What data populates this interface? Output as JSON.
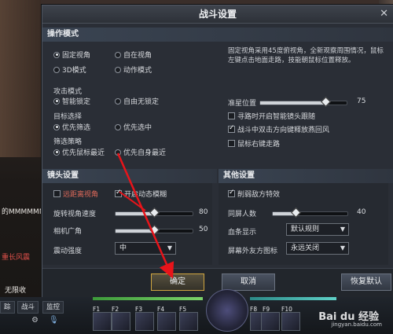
{
  "background": {
    "chat_line": "的MMMMMM",
    "red_text": "重长风震",
    "no_limit": "无限收",
    "hud_tabs": [
      "踪",
      "战斗",
      "监控"
    ]
  },
  "dialog": {
    "title": "战斗设置",
    "close_icon": "close-icon",
    "operation": {
      "header": "操作模式",
      "modes": [
        {
          "label": "固定视角",
          "selected": true
        },
        {
          "label": "自在视角",
          "selected": false
        },
        {
          "label": "3D模式",
          "selected": false
        },
        {
          "label": "动作模式",
          "selected": false
        }
      ],
      "description": "固定视角采用45度俯视角，全新观察周围情况，鼠标左键点击地面走路，技能朝鼠标位置释放。",
      "attack": {
        "title": "攻击模式",
        "options": [
          {
            "label": "智能锁定",
            "selected": true
          },
          {
            "label": "自由无锁定",
            "selected": false
          }
        ]
      },
      "target": {
        "title": "目标选择",
        "options": [
          {
            "label": "优先筛选",
            "selected": true
          },
          {
            "label": "优先选中",
            "selected": false
          }
        ]
      },
      "filter": {
        "title": "筛选策略",
        "options": [
          {
            "label": "优先鼠标最近",
            "selected": true
          },
          {
            "label": "优先自身最近",
            "selected": false
          }
        ]
      },
      "aim": {
        "label": "准星位置",
        "value": "75",
        "fraction": 0.75
      },
      "checks": [
        {
          "label": "寻路时开启智能镜头跟随",
          "checked": false
        },
        {
          "label": "战斗中双击方向键释放燕回风",
          "checked": true
        },
        {
          "label": "鼠标右键走路",
          "checked": false
        }
      ]
    },
    "camera": {
      "header": "镜头设置",
      "far_view": {
        "label": "远距离视角",
        "checked": false
      },
      "dynamic_blur": {
        "label": "开启动态模糊",
        "checked": true
      },
      "rotation_speed": {
        "label": "旋转视角速度",
        "value": "80",
        "fraction": 0.5
      },
      "fov": {
        "label": "相机广角",
        "value": "50",
        "fraction": 0.5
      },
      "shake": {
        "label": "震动强度",
        "value": "中"
      }
    },
    "other": {
      "header": "其他设置",
      "weaken_enemy": {
        "label": "削弱敌方特效",
        "checked": true
      },
      "same_screen": {
        "label": "同屏人数",
        "value": "40",
        "fraction": 0.3
      },
      "blood_bar": {
        "label": "血条显示",
        "value": "默认规则"
      },
      "offscreen_icon": {
        "label": "屏幕外友方图标",
        "value": "永远关闭"
      }
    },
    "buttons": {
      "confirm": "确定",
      "cancel": "取消",
      "restore": "恢复默认"
    }
  },
  "hud": {
    "fkeys": [
      "F1",
      "F2",
      "F3",
      "F4",
      "F5",
      "F8",
      "F9",
      "F10"
    ]
  },
  "watermark": {
    "brand": "Bai du 经验",
    "url": "jingyan.baidu.com"
  }
}
